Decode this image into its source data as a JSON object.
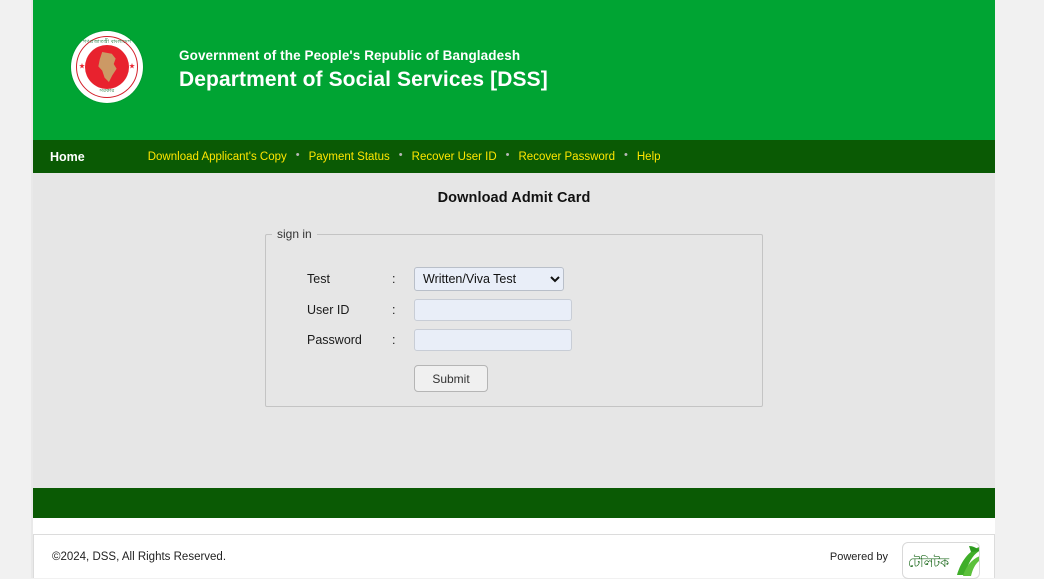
{
  "header": {
    "emblem": {
      "name": "bangladesh-government-emblem",
      "text_top": "গণপ্রজাতন্ত্রী বাংলাদেশ",
      "text_bottom": "সরকার"
    },
    "line1": "Government of the People's Republic of Bangladesh",
    "line2": "Department of Social Services [DSS]",
    "bg_color": "#00a433"
  },
  "nav": {
    "bg_color": "#0a5a04",
    "home_label": "Home",
    "separator": "•",
    "links": [
      {
        "label": "Download Applicant's Copy"
      },
      {
        "label": "Payment Status"
      },
      {
        "label": "Recover User ID"
      },
      {
        "label": "Recover Password"
      },
      {
        "label": "Help"
      }
    ],
    "link_color": "#ffe600"
  },
  "main": {
    "page_title": "Download Admit Card",
    "fieldset_legend": "sign in",
    "bg_color": "#e6e6e6",
    "form": {
      "test": {
        "label": "Test",
        "colon": ":",
        "selected": "Written/Viva Test",
        "options": [
          "Written/Viva Test"
        ]
      },
      "user_id": {
        "label": "User ID",
        "colon": ":",
        "value": "",
        "placeholder": ""
      },
      "password": {
        "label": "Password",
        "colon": ":",
        "value": "",
        "placeholder": ""
      },
      "submit_label": "Submit"
    }
  },
  "footer": {
    "copyright": "©2024, DSS, All Rights Reserved.",
    "powered_by_label": "Powered by",
    "powered_by_logo_text": "টেলিটক",
    "bar_color": "#0a5a04"
  }
}
